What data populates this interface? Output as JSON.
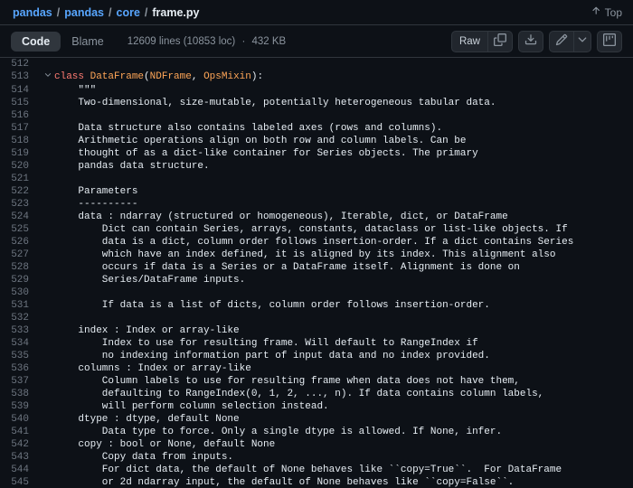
{
  "breadcrumb": {
    "parts": [
      "pandas",
      "pandas",
      "core"
    ],
    "current": "frame.py"
  },
  "top_link": {
    "label": "Top"
  },
  "tabs": {
    "code": "Code",
    "blame": "Blame"
  },
  "file_info": {
    "lines": "12609 lines (10853 loc)",
    "size": "432 KB"
  },
  "toolbar": {
    "raw": "Raw"
  },
  "code": {
    "start": 512,
    "fold_at": 513,
    "lines": [
      {
        "n": 512,
        "segs": [
          [
            "",
            ""
          ]
        ]
      },
      {
        "n": 513,
        "segs": [
          [
            "k-keyword",
            "class "
          ],
          [
            "k-classname",
            "DataFrame"
          ],
          [
            "",
            "("
          ],
          [
            "k-param",
            "NDFrame"
          ],
          [
            "",
            ", "
          ],
          [
            "k-param",
            "OpsMixin"
          ],
          [
            "",
            "):"
          ]
        ]
      },
      {
        "n": 514,
        "segs": [
          [
            "k-doc",
            "    \"\"\""
          ]
        ]
      },
      {
        "n": 515,
        "segs": [
          [
            "k-doc",
            "    Two-dimensional, size-mutable, potentially heterogeneous tabular data."
          ]
        ]
      },
      {
        "n": 516,
        "segs": [
          [
            "",
            ""
          ]
        ]
      },
      {
        "n": 517,
        "segs": [
          [
            "k-doc",
            "    Data structure also contains labeled axes (rows and columns)."
          ]
        ]
      },
      {
        "n": 518,
        "segs": [
          [
            "k-doc",
            "    Arithmetic operations align on both row and column labels. Can be"
          ]
        ]
      },
      {
        "n": 519,
        "segs": [
          [
            "k-doc",
            "    thought of as a dict-like container for Series objects. The primary"
          ]
        ]
      },
      {
        "n": 520,
        "segs": [
          [
            "k-doc",
            "    pandas data structure."
          ]
        ]
      },
      {
        "n": 521,
        "segs": [
          [
            "",
            ""
          ]
        ]
      },
      {
        "n": 522,
        "segs": [
          [
            "k-doc",
            "    Parameters"
          ]
        ]
      },
      {
        "n": 523,
        "segs": [
          [
            "k-doc",
            "    ----------"
          ]
        ]
      },
      {
        "n": 524,
        "segs": [
          [
            "k-doc",
            "    data : ndarray (structured or homogeneous), Iterable, dict, or DataFrame"
          ]
        ]
      },
      {
        "n": 525,
        "segs": [
          [
            "k-doc",
            "        Dict can contain Series, arrays, constants, dataclass or list-like objects. If"
          ]
        ]
      },
      {
        "n": 526,
        "segs": [
          [
            "k-doc",
            "        data is a dict, column order follows insertion-order. If a dict contains Series"
          ]
        ]
      },
      {
        "n": 527,
        "segs": [
          [
            "k-doc",
            "        which have an index defined, it is aligned by its index. This alignment also"
          ]
        ]
      },
      {
        "n": 528,
        "segs": [
          [
            "k-doc",
            "        occurs if data is a Series or a DataFrame itself. Alignment is done on"
          ]
        ]
      },
      {
        "n": 529,
        "segs": [
          [
            "k-doc",
            "        Series/DataFrame inputs."
          ]
        ]
      },
      {
        "n": 530,
        "segs": [
          [
            "",
            ""
          ]
        ]
      },
      {
        "n": 531,
        "segs": [
          [
            "k-doc",
            "        If data is a list of dicts, column order follows insertion-order."
          ]
        ]
      },
      {
        "n": 532,
        "segs": [
          [
            "",
            ""
          ]
        ]
      },
      {
        "n": 533,
        "segs": [
          [
            "k-doc",
            "    index : Index or array-like"
          ]
        ]
      },
      {
        "n": 534,
        "segs": [
          [
            "k-doc",
            "        Index to use for resulting frame. Will default to RangeIndex if"
          ]
        ]
      },
      {
        "n": 535,
        "segs": [
          [
            "k-doc",
            "        no indexing information part of input data and no index provided."
          ]
        ]
      },
      {
        "n": 536,
        "segs": [
          [
            "k-doc",
            "    columns : Index or array-like"
          ]
        ]
      },
      {
        "n": 537,
        "segs": [
          [
            "k-doc",
            "        Column labels to use for resulting frame when data does not have them,"
          ]
        ]
      },
      {
        "n": 538,
        "segs": [
          [
            "k-doc",
            "        defaulting to RangeIndex(0, 1, 2, ..., n). If data contains column labels,"
          ]
        ]
      },
      {
        "n": 539,
        "segs": [
          [
            "k-doc",
            "        will perform column selection instead."
          ]
        ]
      },
      {
        "n": 540,
        "segs": [
          [
            "k-doc",
            "    dtype : dtype, default None"
          ]
        ]
      },
      {
        "n": 541,
        "segs": [
          [
            "k-doc",
            "        Data type to force. Only a single dtype is allowed. If None, infer."
          ]
        ]
      },
      {
        "n": 542,
        "segs": [
          [
            "k-doc",
            "    copy : bool or None, default None"
          ]
        ]
      },
      {
        "n": 543,
        "segs": [
          [
            "k-doc",
            "        Copy data from inputs."
          ]
        ]
      },
      {
        "n": 544,
        "segs": [
          [
            "k-doc",
            "        For dict data, the default of None behaves like ``copy=True``.  For DataFrame"
          ]
        ]
      },
      {
        "n": 545,
        "segs": [
          [
            "k-doc",
            "        or 2d ndarray input, the default of None behaves like ``copy=False``."
          ]
        ]
      }
    ]
  }
}
